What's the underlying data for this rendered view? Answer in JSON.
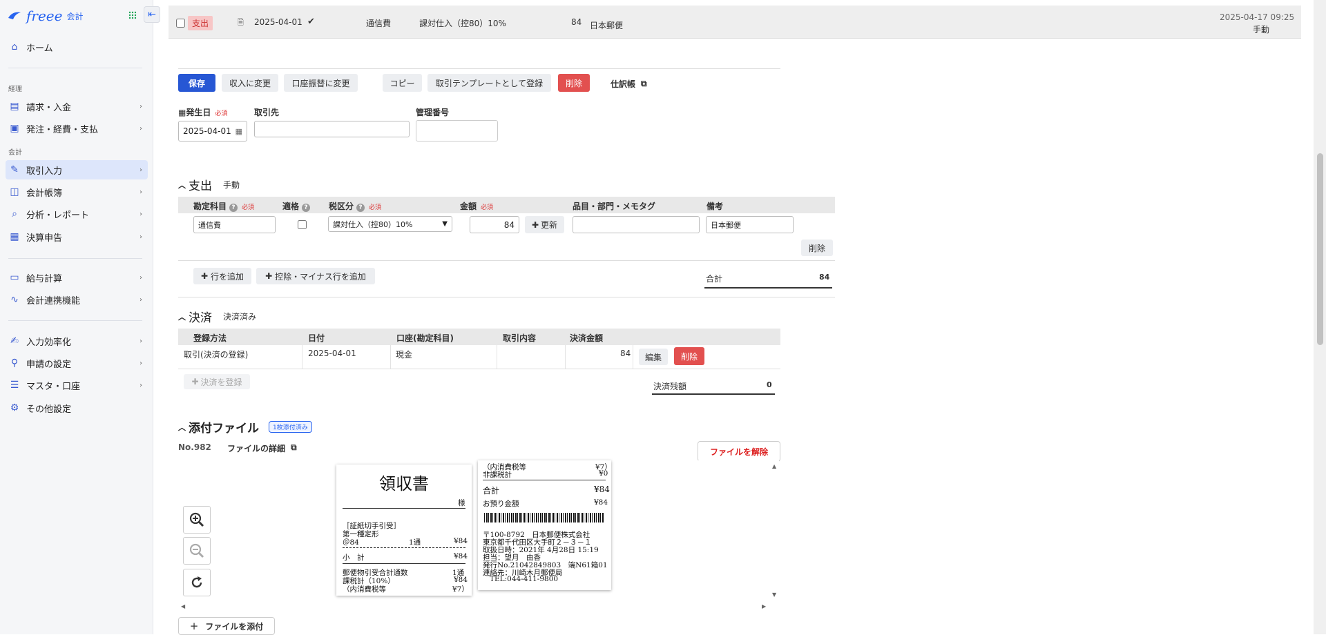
{
  "sidebar": {
    "logo_brand": "freee",
    "logo_sub": "会計",
    "home": "ホーム",
    "sec_keiri": "経理",
    "invoice": "請求・入金",
    "order": "発注・経費・支払",
    "sec_kaikei": "会計",
    "deal_input": "取引入力",
    "ledger": "会計帳簿",
    "analysis": "分析・レポート",
    "closing": "決算申告",
    "payroll": "給与計算",
    "integration": "会計連携機能",
    "efficiency": "入力効率化",
    "approval": "申請の設定",
    "master": "マスタ・口座",
    "other": "その他設定"
  },
  "top_row": {
    "type_badge": "支出",
    "date": "2025-04-01",
    "account": "通信費",
    "tax": "課対仕入（控80）10%",
    "amount": "84",
    "partner": "日本郵便",
    "updated": "2025-04-17 09:25",
    "source": "手動"
  },
  "toolbar": {
    "save": "保存",
    "to_income": "収入に変更",
    "to_transfer": "口座振替に変更",
    "copy": "コピー",
    "register_template": "取引テンプレートとして登録",
    "delete": "削除",
    "journal": "仕訳帳"
  },
  "form": {
    "date_label": "発生日",
    "required": "必須",
    "date_value": "2025-04-01",
    "partner_label": "取引先",
    "partner_value": "",
    "mgmt_label": "管理番号",
    "mgmt_value": ""
  },
  "expense": {
    "title": "支出",
    "subtitle": "手動",
    "headers": {
      "account": "勘定科目",
      "qualified": "適格",
      "tax": "税区分",
      "amount": "金額",
      "items": "品目・部門・メモタグ",
      "memo": "備考"
    },
    "row": {
      "account": "通信費",
      "tax": "課対仕入（控80）10%",
      "amount": "84",
      "update": "更新",
      "items": "",
      "memo": "日本郵便",
      "delete": "削除"
    },
    "add_row": "行を追加",
    "add_minus_row": "控除・マイナス行を追加",
    "total_label": "合計",
    "total_value": "84"
  },
  "settlement": {
    "title": "決済",
    "subtitle": "決済済み",
    "headers": {
      "method": "登録方法",
      "date": "日付",
      "account": "口座(勘定科目)",
      "content": "取引内容",
      "amount": "決済金額"
    },
    "row": {
      "method": "取引(決済の登録)",
      "date": "2025-04-01",
      "account": "現金",
      "content": "",
      "amount": "84",
      "edit": "編集",
      "delete": "削除"
    },
    "register": "決済を登録",
    "balance_label": "決済残額",
    "balance_value": "0"
  },
  "attachment": {
    "title": "添付ファイル",
    "badge": "1枚添付済み",
    "number": "No.982",
    "details": "ファイルの詳細",
    "unlink": "ファイルを解除",
    "add_file": "ファイルを添付"
  },
  "receipt_left": {
    "title": "領収書",
    "sama": "様",
    "l1": "［証紙切手引受］",
    "l2": "第一種定形",
    "l3a": "＠84",
    "l3b": "1通",
    "l3c": "¥84",
    "l4a": "小　計",
    "l4b": "¥84",
    "l5a": "郵便物引受合計通数",
    "l5b": "1通",
    "l6a": "課税計（10%）",
    "l6b": "¥84",
    "l7a": "（内消費税等",
    "l7b": "¥7）"
  },
  "receipt_right": {
    "l1a": "（内消費税等",
    "l1b": "¥7）",
    "l2a": "非課税計",
    "l2b": "¥0",
    "l3a": "合計",
    "l3b": "¥84",
    "l4a": "お預り金額",
    "l4b": "¥84",
    "a1": "〒100-8792　日本郵便株式会社",
    "a2": "東京都千代田区大手町２－３－１",
    "a3": "取扱日時：2021年 4月28日 15:19",
    "a4": "担当：望月　由香",
    "a5": "発行No.21042849803　端N61箱01",
    "a6": "連絡先：川崎木月郵便局",
    "a7": "TEL:044-411-9800"
  }
}
